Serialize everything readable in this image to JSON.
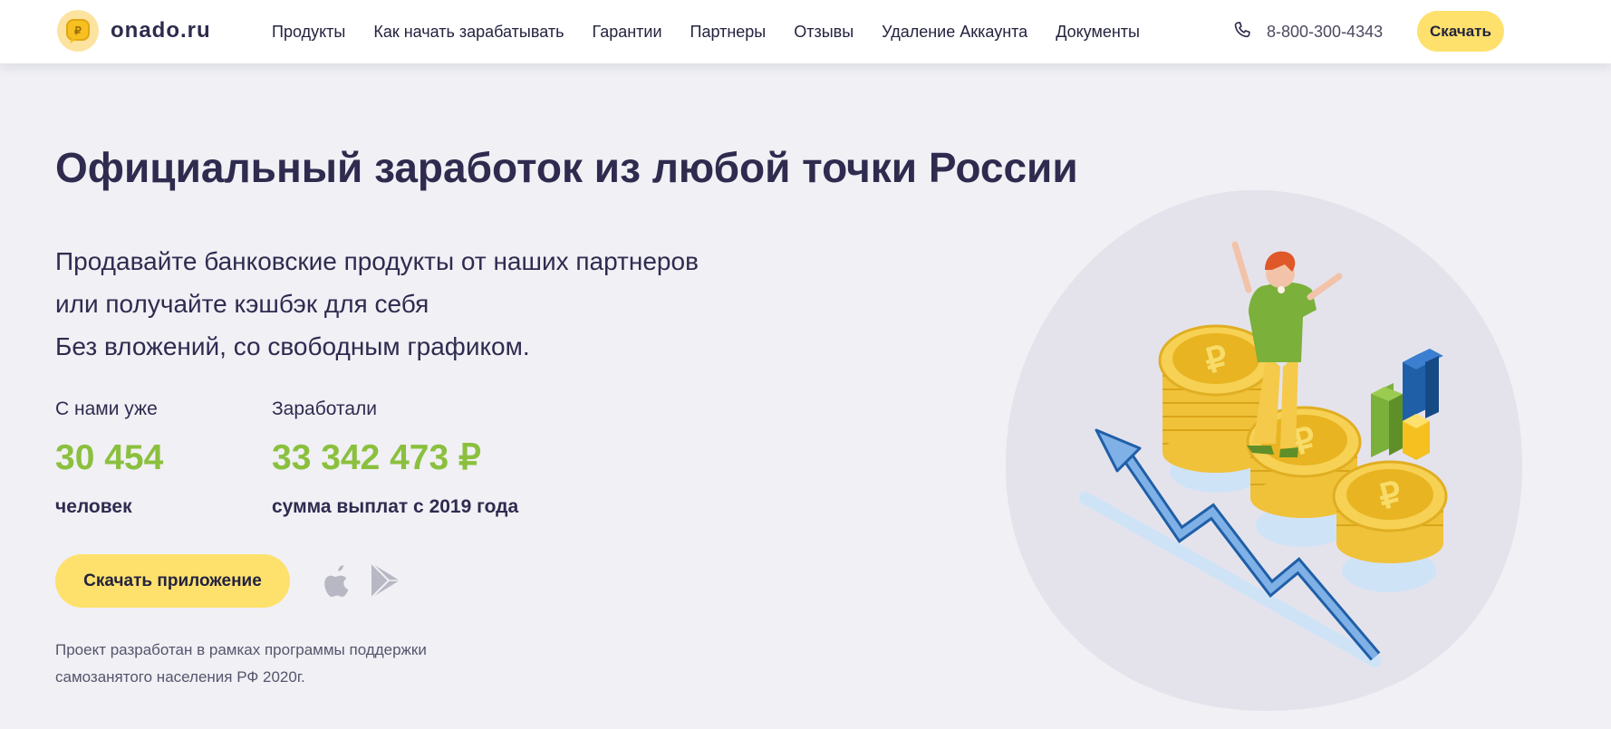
{
  "header": {
    "logo_text": "onado.ru",
    "nav": [
      "Продукты",
      "Как начать зарабатывать",
      "Гарантии",
      "Партнеры",
      "Отзывы",
      "Удаление Аккаунта",
      "Документы"
    ],
    "phone": "8-800-300-4343",
    "download_label": "Скачать"
  },
  "hero": {
    "title": "Официальный заработок из любой точки России",
    "subtitle": [
      "Продавайте банковские продукты от наших партнеров",
      "или получайте кэшбэк для себя",
      "Без вложений, со свободным графиком."
    ],
    "stats": [
      {
        "label": "С нами уже",
        "value": "30 454",
        "caption": "человек"
      },
      {
        "label": "Заработали",
        "value": "33 342 473 ₽",
        "caption": "сумма выплат с 2019 года"
      }
    ],
    "app_button": "Скачать приложение",
    "footnote": [
      "Проект разработан в рамках программы поддержки",
      "самозанятого населения РФ 2020г."
    ]
  },
  "icons": {
    "logo": "ruble-coin-icon",
    "phone": "phone-icon",
    "app_store": "apple-icon",
    "play_store": "google-play-icon"
  },
  "colors": {
    "accent_yellow": "#fde16c",
    "stat_green": "#8bc03e",
    "text_dark": "#2f2b4f",
    "background": "#f0f0f5"
  }
}
